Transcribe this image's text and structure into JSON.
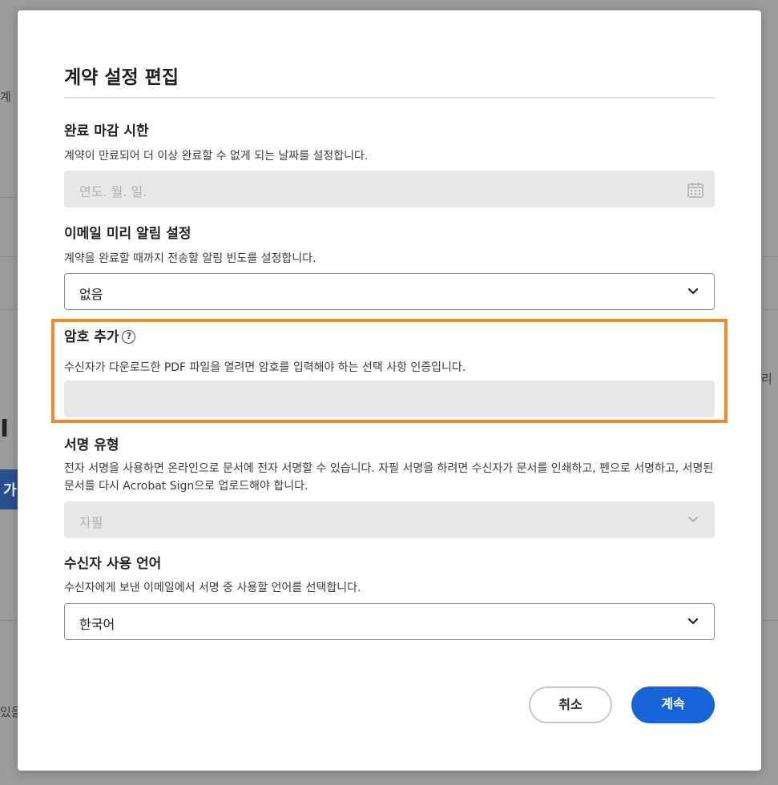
{
  "background": {
    "frag_top": "계",
    "frag_right": "리",
    "frag_btn": "가",
    "frag_big": "I",
    "frag_bottom": "있을"
  },
  "dialog": {
    "title": "계약 설정 편집",
    "deadline": {
      "heading": "완료 마감 시한",
      "description": "계약이 만료되어 더 이상 완료할 수 없게 되는 날짜를 설정합니다.",
      "placeholder": "연도. 월. 일."
    },
    "reminder": {
      "heading": "이메일 미리 알림 설정",
      "description": "계약을 완료할 때까지 전송할 알림 빈도를 설정합니다.",
      "value": "없음"
    },
    "password": {
      "heading": "암호 추가",
      "help_glyph": "?",
      "description": "수신자가 다운로드한 PDF 파일을 열려면 암호를 입력해야 하는 선택 사항 인증입니다.",
      "value": ""
    },
    "signature_type": {
      "heading": "서명 유형",
      "description": "전자 서명을 사용하면 온라인으로 문서에 전자 서명할 수 있습니다. 자필 서명을 하려면 수신자가 문서를 인쇄하고, 펜으로 서명하고, 서명된 문서를 다시 Acrobat Sign으로 업로드해야 합니다.",
      "value": "자필"
    },
    "language": {
      "heading": "수신자 사용 언어",
      "description": "수신자에게 보낸 이메일에서 서명 중 사용할 언어를 선택합니다.",
      "value": "한국어"
    },
    "buttons": {
      "cancel": "취소",
      "continue": "계속"
    }
  },
  "colors": {
    "highlight": "#f0882e",
    "primary": "#1664d8",
    "disabled_field": "#e8e8e8"
  }
}
